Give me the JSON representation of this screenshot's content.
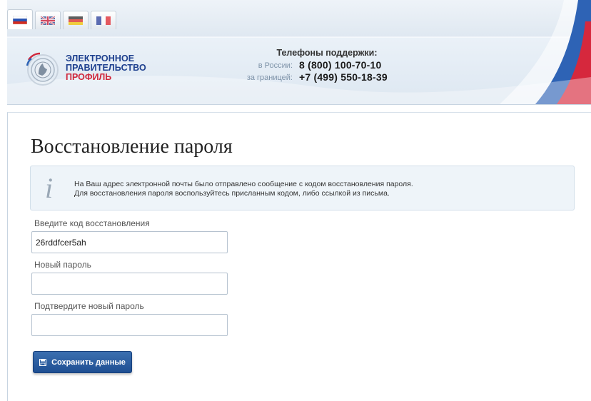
{
  "header": {
    "languages": [
      {
        "code": "ru",
        "active": true
      },
      {
        "code": "en",
        "active": false
      },
      {
        "code": "de",
        "active": false
      },
      {
        "code": "fr",
        "active": false
      }
    ],
    "brand": {
      "line1": "ЭЛЕКТРОННОЕ",
      "line2": "ПРАВИТЕЛЬСТВО",
      "line3": "ПРОФИЛЬ"
    },
    "support": {
      "title": "Телефоны поддержки:",
      "russia_label": "в России:",
      "russia_phone": "8 (800) 100-70-10",
      "abroad_label": "за границей:",
      "abroad_phone": "+7 (499) 550-18-39"
    }
  },
  "main": {
    "title": "Восстановление пароля",
    "info": {
      "line1": "На Ваш адрес электронной почты было отправлено сообщение с кодом восстановления пароля.",
      "line2": "Для восстановления пароля воспользуйтесь присланным кодом, либо ссылкой из письма."
    },
    "form": {
      "code_label": "Введите код восстановления",
      "code_value": "26rddfcer5ah",
      "new_password_label": "Новый пароль",
      "new_password_value": "",
      "confirm_password_label": "Подтвердите новый пароль",
      "confirm_password_value": "",
      "save_label": "Сохранить данные"
    }
  },
  "colors": {
    "brand_blue": "#1d3f8e",
    "brand_red": "#d0283c",
    "button": "#24559b"
  }
}
